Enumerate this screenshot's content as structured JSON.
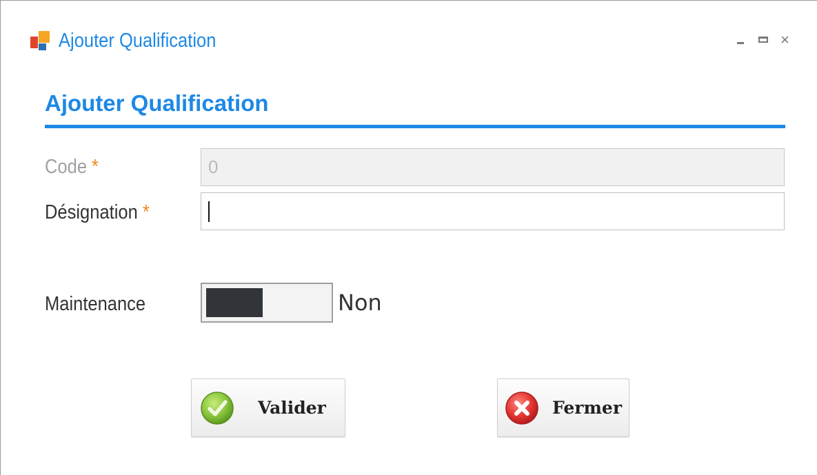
{
  "window": {
    "title": "Ajouter Qualification",
    "controls": {
      "minimize": "minimize",
      "maximize": "maximize",
      "close": "close"
    }
  },
  "form": {
    "heading": "Ajouter Qualification",
    "fields": [
      {
        "label": "Code",
        "required_mark": "*",
        "value": "0",
        "disabled": true
      },
      {
        "label": "Désignation",
        "required_mark": "*",
        "value": "",
        "disabled": false
      }
    ],
    "maintenance": {
      "label": "Maintenance",
      "state_text": "Non",
      "on": false
    }
  },
  "buttons": {
    "validate": {
      "label": "Valider",
      "icon": "check-circle-icon"
    },
    "close": {
      "label": "Fermer",
      "icon": "x-circle-icon"
    }
  },
  "colors": {
    "accent": "#1e88e5",
    "required": "#f0891c",
    "toggle_knob": "#313539"
  }
}
